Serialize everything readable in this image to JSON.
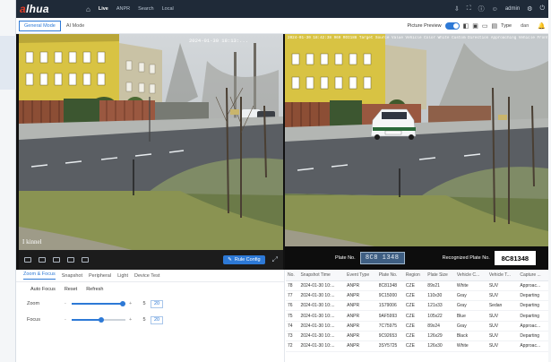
{
  "app": {
    "logo": "alhua",
    "nav": [
      "Live",
      "ANPR",
      "Search",
      "Local"
    ],
    "active_nav": "Live",
    "user": "admin"
  },
  "modes": [
    "General Mode",
    "AI Mode"
  ],
  "picture_preview": {
    "label": "Picture Preview",
    "type_label": "Type",
    "type_value": "dan"
  },
  "left_video": {
    "timestamp": "2024-01-30 18:13:...",
    "rule_config_label": "Rule Config",
    "watermark": "Ⓚ"
  },
  "right_video": {
    "info_text": "2024-01-30 18:42:38 969 ROI188 Target Source Value Vehicle Color White Custom Direction Approaching Vehicle Front or Back Vehicle Front",
    "plate_no_label": "Plate No.",
    "plate_image_text": "8C8 1348",
    "recognized_label": "Recognized Plate No.",
    "recognized_value": "8C81348"
  },
  "bottom_tabs": [
    "Zoom & Focus",
    "Snapshot",
    "Peripheral",
    "Light",
    "Device Test"
  ],
  "focus_buttons": [
    "Auto Focus",
    "Reset",
    "Refresh"
  ],
  "sliders": [
    {
      "name": "Zoom",
      "minus": "-",
      "plus": "+",
      "step": "5",
      "value": "20",
      "level": 0.95
    },
    {
      "name": "Focus",
      "minus": "-",
      "plus": "+",
      "step": "5",
      "value": "20",
      "level": 0.55
    }
  ],
  "table": {
    "columns": [
      "No.",
      "Snapshot Time",
      "Event Type",
      "Plate No.",
      "Region",
      "Plate Size",
      "Vehicle C...",
      "Vehicle T...",
      "Capture ..."
    ],
    "rows": [
      [
        "78",
        "2024-01-30 10:...",
        "ANPR",
        "8C81348",
        "CZE",
        "89x21",
        "White",
        "SUV",
        "Approac..."
      ],
      [
        "77",
        "2024-01-30 10:...",
        "ANPR",
        "9C15000",
        "CZE",
        "110x30",
        "Gray",
        "SUV",
        "Departing"
      ],
      [
        "76",
        "2024-01-30 10:...",
        "ANPR",
        "1S79006",
        "CZE",
        "121x33",
        "Gray",
        "Sedan",
        "Departing"
      ],
      [
        "75",
        "2024-01-30 10:...",
        "ANPR",
        "9AF5993",
        "CZE",
        "105x22",
        "Blue",
        "SUV",
        "Departing"
      ],
      [
        "74",
        "2024-01-30 10:...",
        "ANPR",
        "7C75975",
        "CZE",
        "89x24",
        "Gray",
        "SUV",
        "Approac..."
      ],
      [
        "73",
        "2024-01-30 10:...",
        "ANPR",
        "9C92653",
        "CZE",
        "126x29",
        "Black",
        "SUV",
        "Departing"
      ],
      [
        "72",
        "2024-01-30 10:...",
        "ANPR",
        "3SY5725",
        "CZE",
        "126x30",
        "White",
        "SUV",
        "Approac..."
      ]
    ]
  },
  "colors": {
    "topbar": "#1f2a38",
    "accent": "#2d79d6",
    "logo_red": "#e23d28"
  }
}
